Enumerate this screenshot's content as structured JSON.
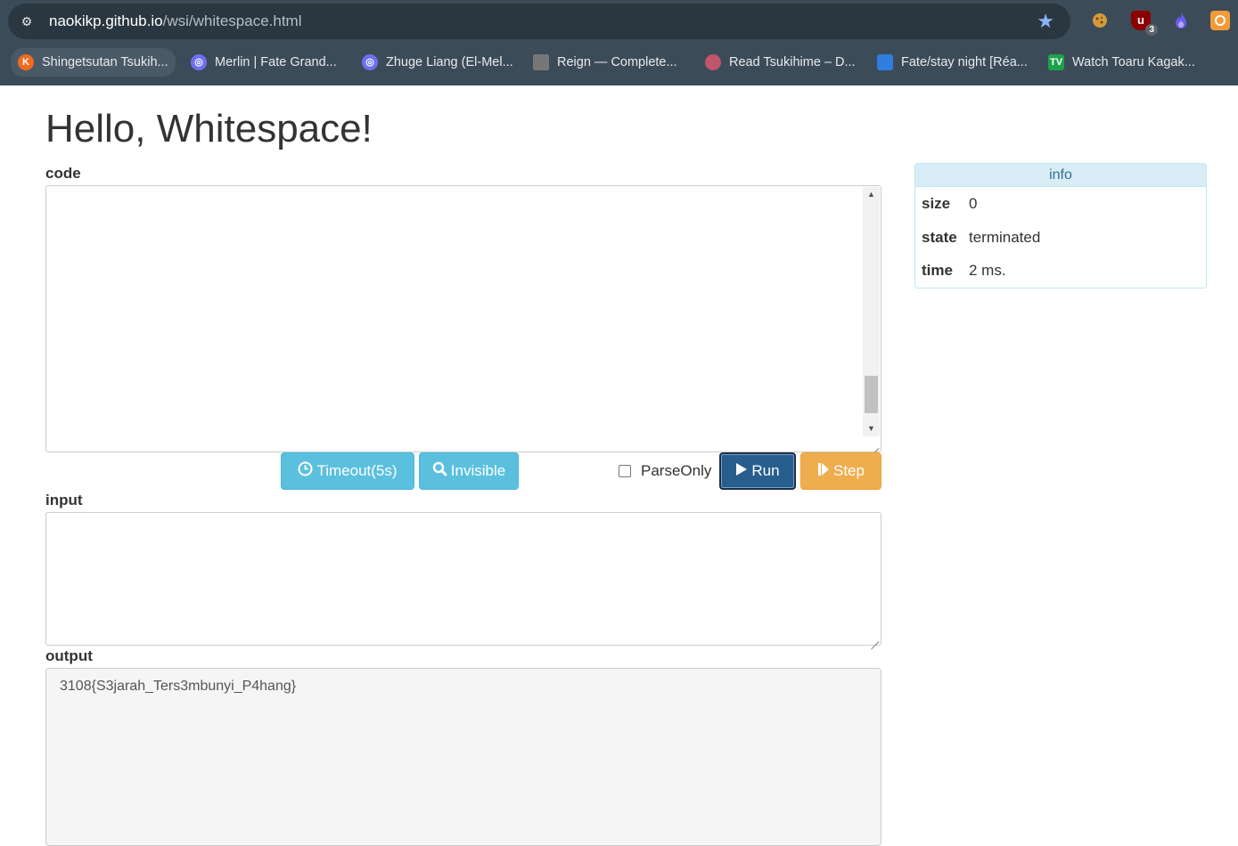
{
  "browser": {
    "url_host": "naokikp.github.io",
    "url_path": "/wsi/whitespace.html",
    "bookmarks": [
      {
        "label": "Shingetsutan Tsukih...",
        "color": "#f26a21"
      },
      {
        "label": "Merlin | Fate Grand...",
        "color": "#6f6ff2"
      },
      {
        "label": "Zhuge Liang (El-Mel...",
        "color": "#6f6ff2"
      },
      {
        "label": "Reign — Complete...",
        "color": "#777777"
      },
      {
        "label": "Read Tsukihime – D...",
        "color": "#c0566a"
      },
      {
        "label": "Fate/stay night [Réa...",
        "color": "#2f7de1"
      },
      {
        "label": "Watch Toaru Kagak...",
        "color": "#1ca34a"
      }
    ],
    "extensions": [
      {
        "name": "cookie-icon",
        "color": "#d29a3b"
      },
      {
        "name": "ublock-icon",
        "color": "#8b0000",
        "badge": "3"
      },
      {
        "name": "flame-icon",
        "color": "#6a5cf0"
      },
      {
        "name": "extension-icon",
        "color": "#f29b38"
      }
    ]
  },
  "page": {
    "title": "Hello, Whitespace!",
    "code_label": "code",
    "input_label": "input",
    "output_label": "output",
    "buttons": {
      "timeout": "Timeout(5s)",
      "invisible": "Invisible",
      "parse_only": "ParseOnly",
      "run": "Run",
      "step": "Step"
    },
    "output_text": "3108{S3jarah_Ters3mbunyi_P4hang}"
  },
  "info": {
    "heading": "info",
    "rows": [
      {
        "key": "size",
        "value": "0"
      },
      {
        "key": "state",
        "value": "terminated"
      },
      {
        "key": "time",
        "value": "2 ms."
      }
    ]
  }
}
